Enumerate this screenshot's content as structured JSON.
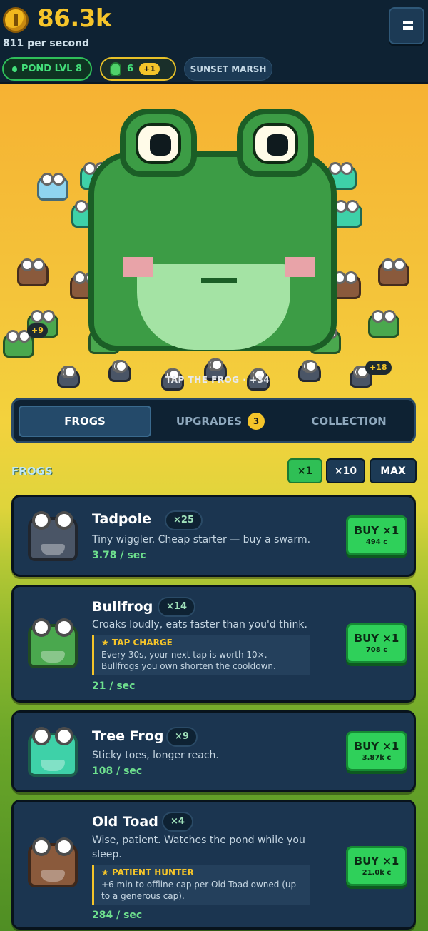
{
  "header": {
    "coins": "86.3k",
    "per_second": "811 per second",
    "pond_level": "POND LVL 8",
    "gems": "6",
    "gem_bonus": "+1",
    "location": "SUNSET MARSH"
  },
  "scene": {
    "float_numbers": [
      "+9",
      "+18"
    ],
    "tap_hint": "TAP THE FROG · +34"
  },
  "tabs": {
    "frogs": "FROGS",
    "upgrades": "UPGRADES",
    "upgrades_badge": "3",
    "collection": "COLLECTION"
  },
  "section": {
    "title": "FROGS",
    "qty": [
      "×1",
      "×10",
      "MAX"
    ]
  },
  "cards": [
    {
      "name": "Tadpole",
      "count": "×25",
      "desc": "Tiny wiggler. Cheap starter — buy a swarm.",
      "rate": "3.78 / sec",
      "buy": "BUY ×1",
      "cost": "494 c",
      "color": "#4a5566"
    },
    {
      "name": "Bullfrog",
      "count": "×14",
      "desc": "Croaks loudly, eats faster than you'd think.",
      "ability_title": "★ TAP CHARGE",
      "ability_text": "Every 30s, your next tap is worth 10×. Bullfrogs you own shorten the cooldown.",
      "rate": "21 / sec",
      "buy": "BUY ×1",
      "cost": "708 c",
      "color": "#4aa84e"
    },
    {
      "name": "Tree Frog",
      "count": "×9",
      "desc": "Sticky toes, longer reach.",
      "rate": "108 / sec",
      "buy": "BUY ×1",
      "cost": "3.87k c",
      "color": "#3ed1a8"
    },
    {
      "name": "Old Toad",
      "count": "×4",
      "desc": "Wise, patient. Watches the pond while you sleep.",
      "ability_title": "★ PATIENT HUNTER",
      "ability_text": "+6 min to offline cap per Old Toad owned (up to a generous cap).",
      "rate": "284 / sec",
      "buy": "BUY ×1",
      "cost": "21.0k c",
      "color": "#8a5a3c"
    }
  ]
}
